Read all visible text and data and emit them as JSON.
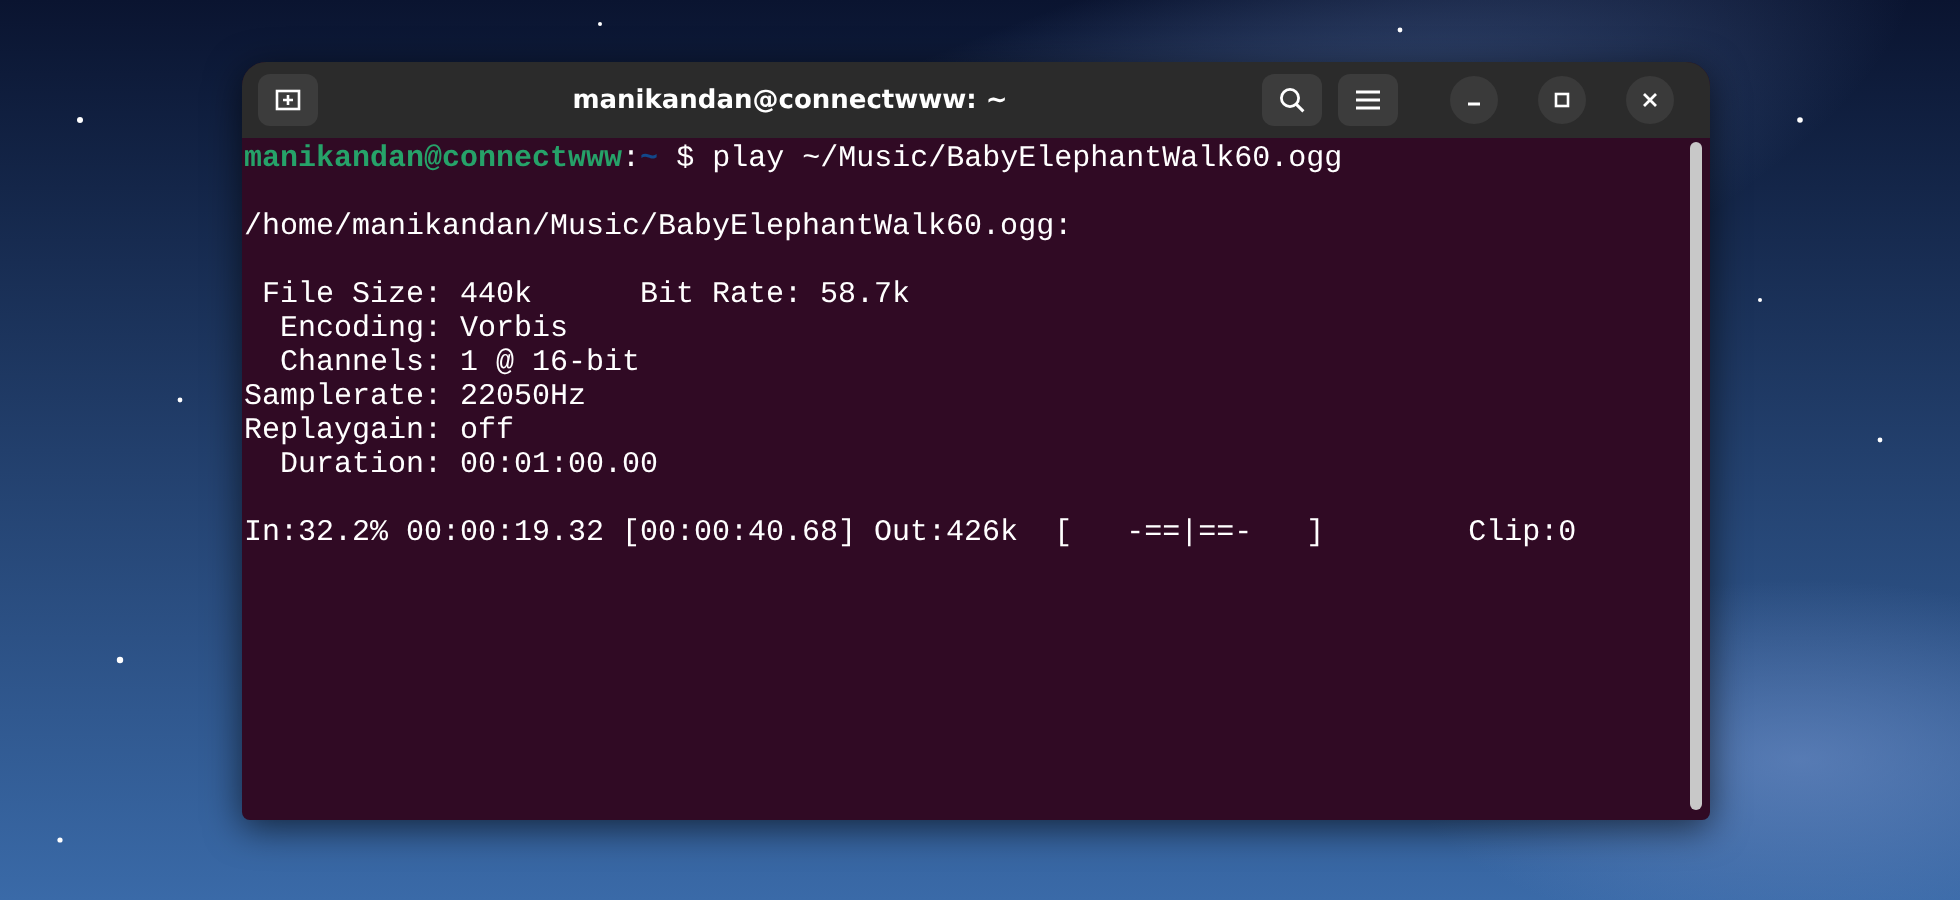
{
  "window": {
    "title": "manikandan@connectwww: ~"
  },
  "prompt": {
    "user_host": "manikandan@connectwww",
    "separator": ":",
    "cwd": "~",
    "command": "$ play ~/Music/BabyElephantWalk60.ogg"
  },
  "output_blocks": [
    [
      "/home/manikandan/Music/BabyElephantWalk60.ogg:"
    ],
    [
      " File Size: 440k      Bit Rate: 58.7k",
      "  Encoding: Vorbis",
      "  Channels: 1 @ 16-bit",
      "Samplerate: 22050Hz",
      "Replaygain: off",
      "  Duration: 00:01:00.00"
    ],
    [
      "In:32.2% 00:00:19.32 [00:00:40.68] Out:426k  [   -==|==-   ]        Clip:0"
    ]
  ]
}
